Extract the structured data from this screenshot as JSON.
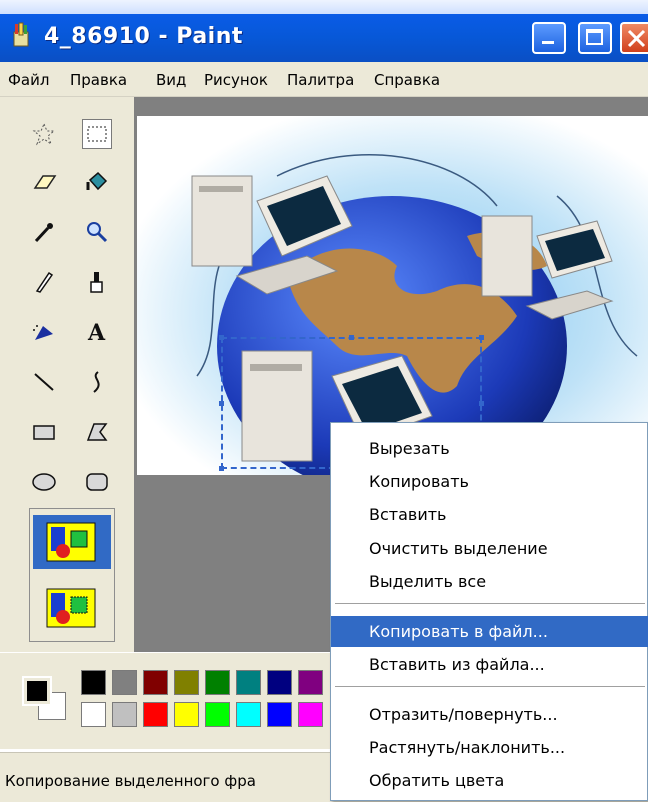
{
  "window": {
    "title": "4_86910 - Paint",
    "buttons": [
      "minimize",
      "maximize",
      "close"
    ]
  },
  "menubar": {
    "items": [
      "Файл",
      "Правка",
      "Вид",
      "Рисунок",
      "Палитра",
      "Справка"
    ]
  },
  "toolbox": {
    "tools": [
      {
        "icon": "free-select-icon",
        "glyph": "☆"
      },
      {
        "icon": "rect-select-icon",
        "glyph": "⬚"
      },
      {
        "icon": "eraser-icon",
        "glyph": "▱"
      },
      {
        "icon": "fill-icon",
        "glyph": "◆"
      },
      {
        "icon": "eyedropper-icon",
        "glyph": "✎"
      },
      {
        "icon": "magnifier-icon",
        "glyph": "🔍"
      },
      {
        "icon": "pencil-icon",
        "glyph": "✏"
      },
      {
        "icon": "brush-icon",
        "glyph": "♜"
      },
      {
        "icon": "airbrush-icon",
        "glyph": "◣"
      },
      {
        "icon": "text-icon",
        "glyph": "A"
      },
      {
        "icon": "line-icon",
        "glyph": "╲"
      },
      {
        "icon": "curve-icon",
        "glyph": "§"
      },
      {
        "icon": "rectangle-icon",
        "glyph": "▭"
      },
      {
        "icon": "polygon-icon",
        "glyph": "⏢"
      },
      {
        "icon": "ellipse-icon",
        "glyph": "⬭"
      },
      {
        "icon": "rounded-rect-icon",
        "glyph": "▢"
      }
    ]
  },
  "palette": {
    "foreground": "#000000",
    "background": "#ffffff",
    "row1": [
      "#000000",
      "#808080",
      "#800000",
      "#808000",
      "#008000",
      "#008080",
      "#000080",
      "#800080"
    ],
    "row2": [
      "#ffffff",
      "#c0c0c0",
      "#ff0000",
      "#ffff00",
      "#00ff00",
      "#00ffff",
      "#0000ff",
      "#ff00ff"
    ]
  },
  "statusbar": {
    "text": "Копирование выделенного фра"
  },
  "context_menu": {
    "items": [
      {
        "label": "Вырезать"
      },
      {
        "label": "Копировать"
      },
      {
        "label": "Вставить"
      },
      {
        "label": "Очистить выделение"
      },
      {
        "label": "Выделить все"
      },
      {
        "label": "Копировать в файл...",
        "highlighted": true
      },
      {
        "label": "Вставить из файла..."
      },
      {
        "label": "Отразить/повернуть..."
      },
      {
        "label": "Растянуть/наклонить..."
      },
      {
        "label": "Обратить цвета"
      }
    ]
  },
  "colors": {
    "title_blue": "#0758d8",
    "highlight": "#316ac5",
    "face": "#ece9d8"
  }
}
